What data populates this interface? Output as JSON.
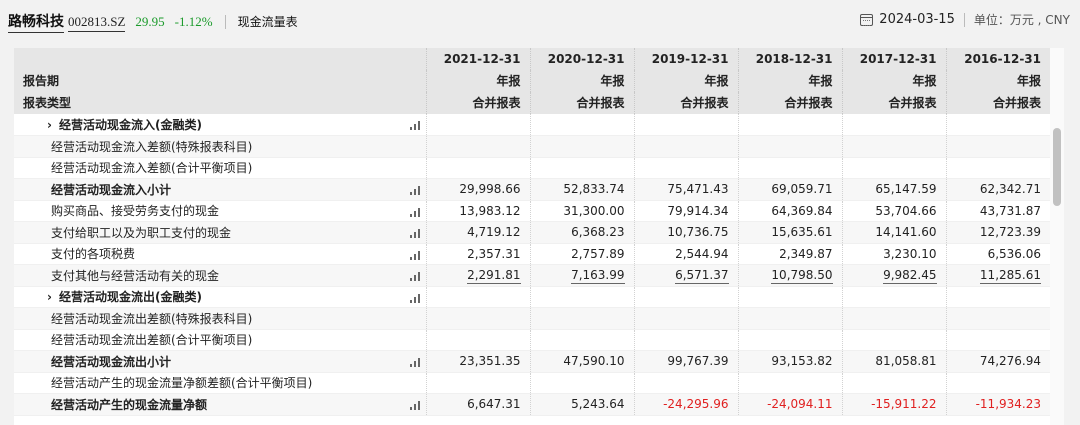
{
  "header": {
    "stock_name": "路畅科技",
    "stock_code": "002813.SZ",
    "price": "29.95",
    "change": "-1.12%",
    "report_name": "现金流量表",
    "date": "2024-03-15",
    "unit": "单位：万元 , CNY",
    "change_color": "#1a9a2a"
  },
  "table": {
    "header_rows": [
      {
        "label": "",
        "cells": [
          "2021-12-31",
          "2020-12-31",
          "2019-12-31",
          "2018-12-31",
          "2017-12-31",
          "2016-12-31"
        ]
      },
      {
        "label": "报告期",
        "cells": [
          "年报",
          "年报",
          "年报",
          "年报",
          "年报",
          "年报"
        ]
      },
      {
        "label": "报表类型",
        "cells": [
          "合并报表",
          "合并报表",
          "合并报表",
          "合并报表",
          "合并报表",
          "合并报表"
        ]
      }
    ],
    "rows": [
      {
        "label": "经营活动现金流入(金融类)",
        "expand": true,
        "bold": true,
        "chart": true,
        "values": [
          "",
          "",
          "",
          "",
          "",
          ""
        ]
      },
      {
        "label": "经营活动现金流入差额(特殊报表科目)",
        "bold": false,
        "chart": false,
        "values": [
          "",
          "",
          "",
          "",
          "",
          ""
        ]
      },
      {
        "label": "经营活动现金流入差额(合计平衡项目)",
        "bold": false,
        "chart": false,
        "values": [
          "",
          "",
          "",
          "",
          "",
          ""
        ]
      },
      {
        "label": "经营活动现金流入小计",
        "bold": true,
        "chart": true,
        "values": [
          "29,998.66",
          "52,833.74",
          "75,471.43",
          "69,059.71",
          "65,147.59",
          "62,342.71"
        ]
      },
      {
        "label": "购买商品、接受劳务支付的现金",
        "bold": false,
        "chart": true,
        "values": [
          "13,983.12",
          "31,300.00",
          "79,914.34",
          "64,369.84",
          "53,704.66",
          "43,731.87"
        ]
      },
      {
        "label": "支付给职工以及为职工支付的现金",
        "bold": false,
        "chart": true,
        "values": [
          "4,719.12",
          "6,368.23",
          "10,736.75",
          "15,635.61",
          "14,141.60",
          "12,723.39"
        ]
      },
      {
        "label": "支付的各项税费",
        "bold": false,
        "chart": true,
        "values": [
          "2,357.31",
          "2,757.89",
          "2,544.94",
          "2,349.87",
          "3,230.10",
          "6,536.06"
        ]
      },
      {
        "label": "支付其他与经营活动有关的现金",
        "bold": false,
        "chart": true,
        "underline": true,
        "values": [
          "2,291.81",
          "7,163.99",
          "6,571.37",
          "10,798.50",
          "9,982.45",
          "11,285.61"
        ]
      },
      {
        "label": "经营活动现金流出(金融类)",
        "expand": true,
        "bold": true,
        "chart": true,
        "values": [
          "",
          "",
          "",
          "",
          "",
          ""
        ]
      },
      {
        "label": "经营活动现金流出差额(特殊报表科目)",
        "bold": false,
        "chart": false,
        "values": [
          "",
          "",
          "",
          "",
          "",
          ""
        ]
      },
      {
        "label": "经营活动现金流出差额(合计平衡项目)",
        "bold": false,
        "chart": false,
        "values": [
          "",
          "",
          "",
          "",
          "",
          ""
        ]
      },
      {
        "label": "经营活动现金流出小计",
        "bold": true,
        "chart": true,
        "values": [
          "23,351.35",
          "47,590.10",
          "99,767.39",
          "93,153.82",
          "81,058.81",
          "74,276.94"
        ]
      },
      {
        "label": "经营活动产生的现金流量净额差额(合计平衡项目)",
        "bold": false,
        "chart": false,
        "values": [
          "",
          "",
          "",
          "",
          "",
          ""
        ]
      },
      {
        "label": "经营活动产生的现金流量净额",
        "bold": true,
        "chart": true,
        "values": [
          "6,647.31",
          "5,243.64",
          "-24,295.96",
          "-24,094.11",
          "-15,911.22",
          "-11,934.23"
        ]
      }
    ],
    "negative_color": "#e02020"
  }
}
